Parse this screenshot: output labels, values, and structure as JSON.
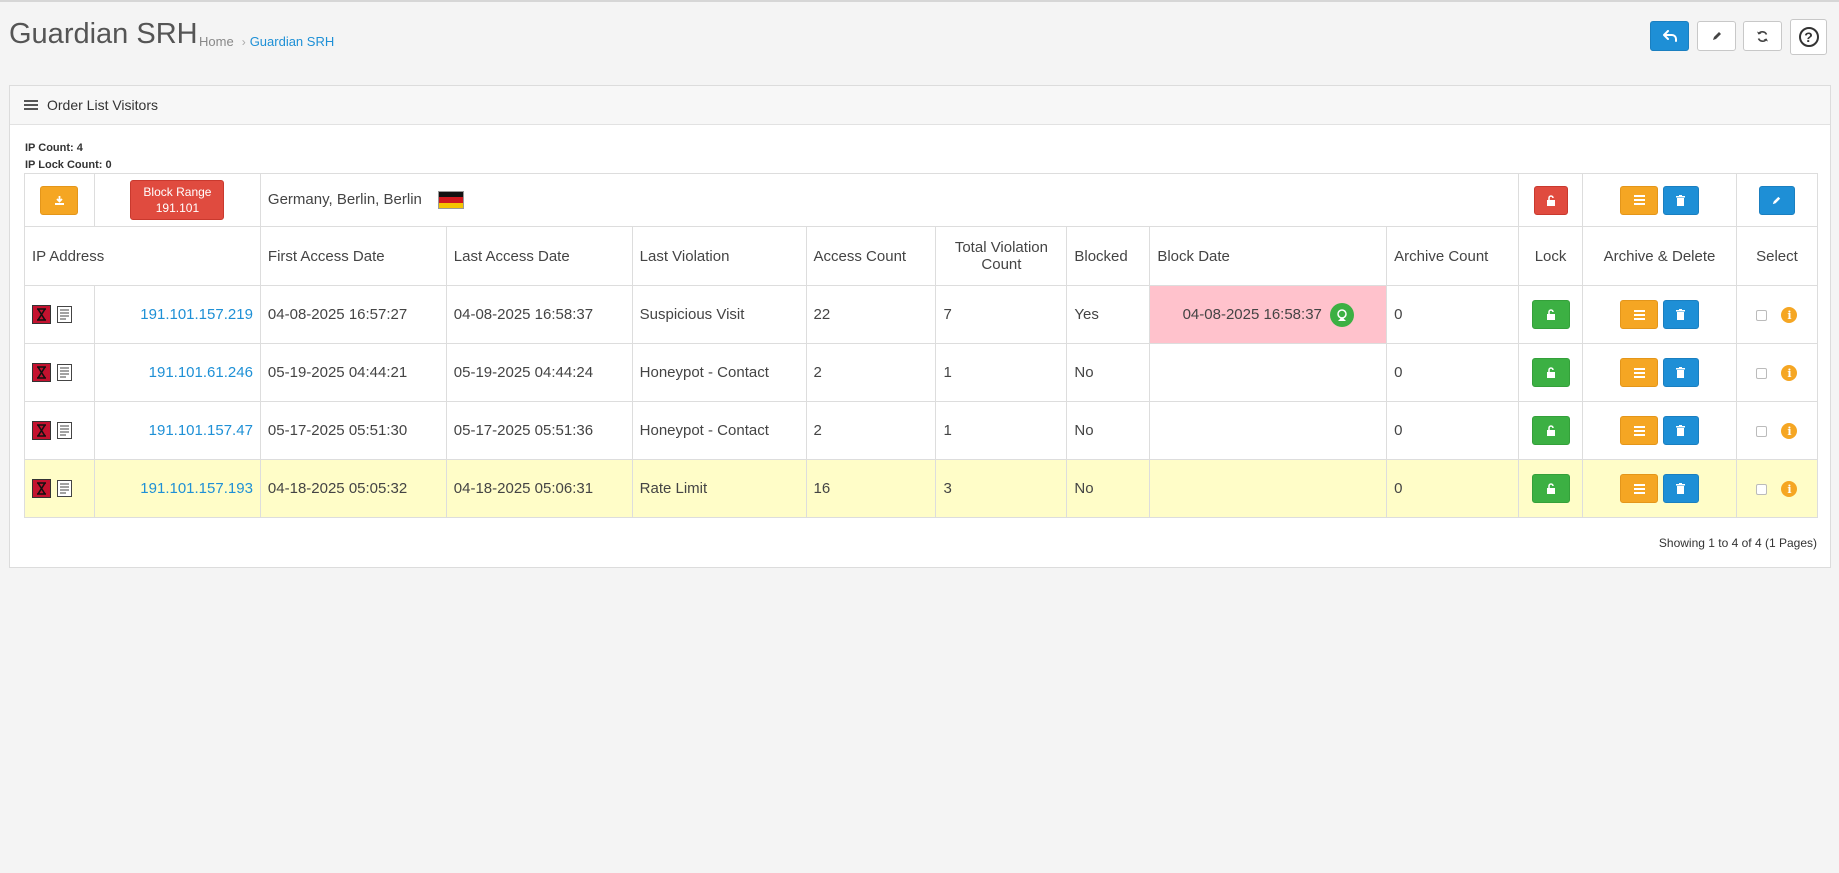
{
  "page": {
    "title": "Guardian SRH"
  },
  "breadcrumb": {
    "home": "Home",
    "separator": "›",
    "current": "Guardian SRH"
  },
  "header_buttons": [
    "back-icon",
    "pencil-icon",
    "refresh-icon",
    "help-icon"
  ],
  "help": {
    "glyph": "?"
  },
  "panel": {
    "title": "Order List Visitors"
  },
  "counts": {
    "ip_count": "IP Count: 4",
    "ip_lock_count": "IP Lock Count: 0"
  },
  "toolbar": {
    "block_range_line1": "Block Range",
    "block_range_line2": "191.101",
    "location": "Germany, Berlin, Berlin"
  },
  "columns": {
    "ip": "IP Address",
    "first": "First Access Date",
    "last": "Last Access Date",
    "violation": "Last Violation",
    "access": "Access Count",
    "total_violation": "Total Violation Count",
    "blocked": "Blocked",
    "block_date": "Block Date",
    "archive": "Archive Count",
    "lock": "Lock",
    "archive_delete": "Archive & Delete",
    "select": "Select"
  },
  "rows": [
    {
      "ip": "191.101.157.219",
      "first": "04-08-2025 16:57:27",
      "last": "04-08-2025 16:58:37",
      "violation": "Suspicious Visit",
      "access": "22",
      "total_violation": "7",
      "blocked": "Yes",
      "block_date": "04-08-2025 16:58:37",
      "archive": "0"
    },
    {
      "ip": "191.101.61.246",
      "first": "05-19-2025 04:44:21",
      "last": "05-19-2025 04:44:24",
      "violation": "Honeypot - Contact",
      "access": "2",
      "total_violation": "1",
      "blocked": "No",
      "block_date": "",
      "archive": "0"
    },
    {
      "ip": "191.101.157.47",
      "first": "05-17-2025 05:51:30",
      "last": "05-17-2025 05:51:36",
      "violation": "Honeypot - Contact",
      "access": "2",
      "total_violation": "1",
      "blocked": "No",
      "block_date": "",
      "archive": "0"
    },
    {
      "ip": "191.101.157.193",
      "first": "04-18-2025 05:05:32",
      "last": "04-18-2025 05:06:31",
      "violation": "Rate Limit",
      "access": "16",
      "total_violation": "3",
      "blocked": "No",
      "block_date": "",
      "archive": "0"
    }
  ],
  "info_glyph": "i",
  "footer": {
    "showing": "Showing 1 to 4 of 4 (1 Pages)"
  },
  "colors": {
    "primary": "#1e8fd6",
    "success": "#3cb043",
    "warning": "#f5a623",
    "danger": "#e04b3f",
    "blocked_row": "#ffc2cc",
    "highlight_row": "#fffdc8"
  }
}
